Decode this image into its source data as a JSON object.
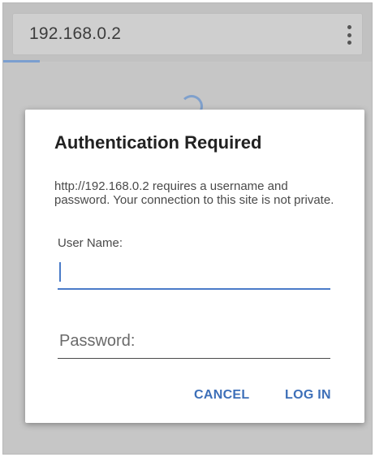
{
  "browser": {
    "url": "192.168.0.2",
    "menu_icon": "more-vert-icon",
    "loading_progress": 0.1
  },
  "dialog": {
    "title": "Authentication Required",
    "message": "http://192.168.0.2 requires a username and password. Your connection to this site is not private.",
    "username_label": "User Name:",
    "username_value": "",
    "password_placeholder": "Password:",
    "password_value": "",
    "cancel_label": "CANCEL",
    "login_label": "LOG IN"
  },
  "colors": {
    "accent": "#3d6fb8",
    "field_focus": "#4a7bc8",
    "dialog_background": "#ffffff",
    "scrim": "#c6c6c6"
  }
}
